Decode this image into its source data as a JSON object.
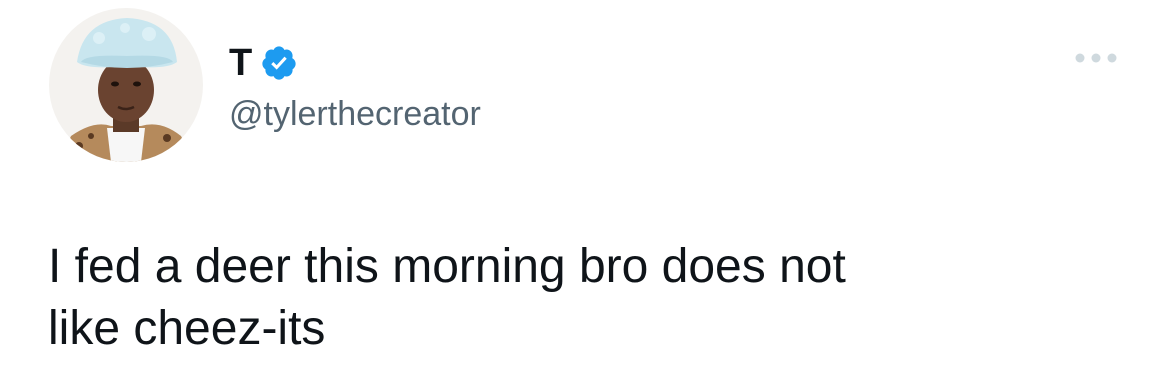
{
  "author": {
    "display_name": "T",
    "handle": "@tylerthecreator",
    "verified": true
  },
  "icons": {
    "verified": "verified-badge-icon",
    "more": "more-options-icon",
    "avatar": "profile-photo"
  },
  "tweet": {
    "text": "I fed a deer this morning bro does not\nlike cheez-its"
  },
  "colors": {
    "text": "#0f1419",
    "secondary": "#536471",
    "verified": "#1d9bf0",
    "icon_muted": "#cfd9de"
  }
}
